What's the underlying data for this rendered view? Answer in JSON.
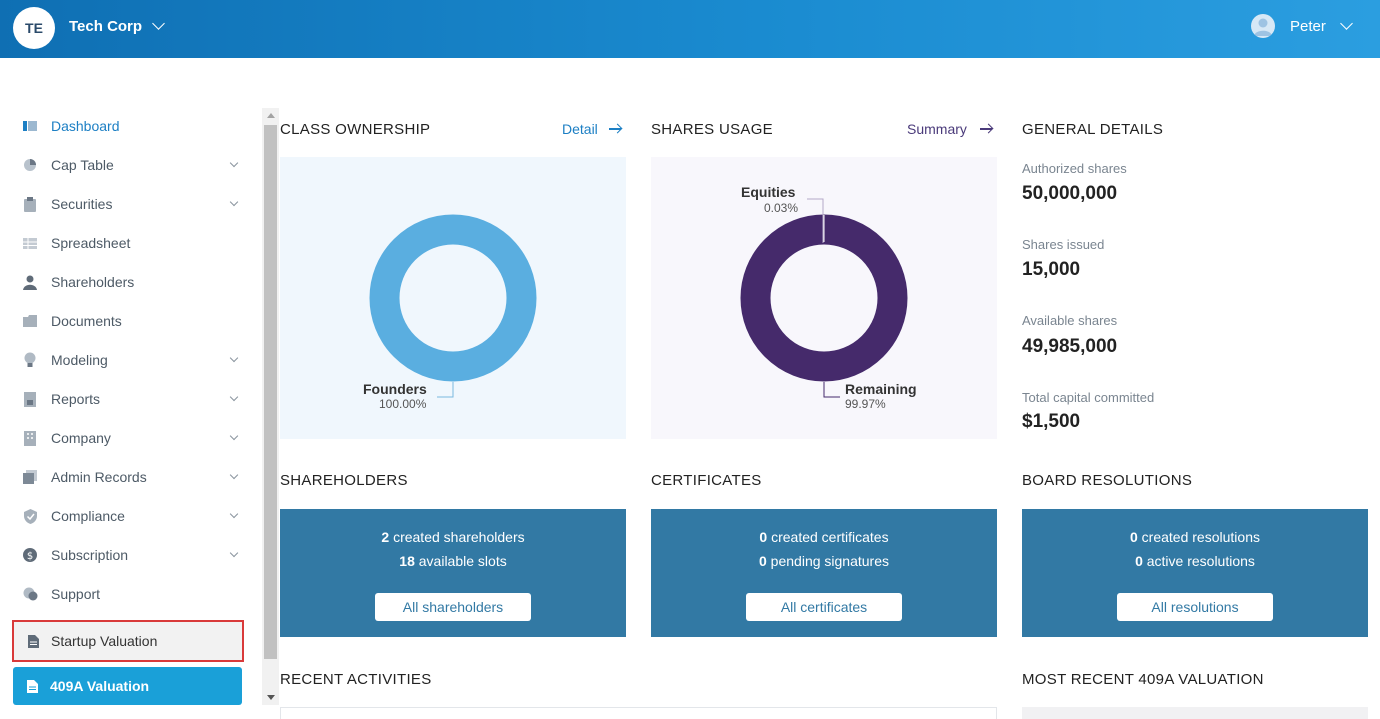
{
  "header": {
    "org_initials": "TE",
    "org_name": "Tech Corp",
    "user_name": "Peter"
  },
  "sidebar": {
    "items": [
      {
        "label": "Dashboard",
        "icon": "dashboard-icon",
        "active": true
      },
      {
        "label": "Cap Table",
        "icon": "pie-chart-icon"
      },
      {
        "label": "Securities",
        "icon": "clipboard-icon"
      },
      {
        "label": "Spreadsheet",
        "icon": "spreadsheet-icon"
      },
      {
        "label": "Shareholders",
        "icon": "person-icon"
      },
      {
        "label": "Documents",
        "icon": "folder-icon"
      },
      {
        "label": "Modeling",
        "icon": "lightbulb-icon"
      },
      {
        "label": "Reports",
        "icon": "report-icon"
      },
      {
        "label": "Company",
        "icon": "building-icon"
      },
      {
        "label": "Admin Records",
        "icon": "records-icon"
      },
      {
        "label": "Compliance",
        "icon": "shield-icon"
      },
      {
        "label": "Subscription",
        "icon": "dollar-icon"
      },
      {
        "label": "Support",
        "icon": "support-icon"
      }
    ],
    "startup_valuation": "Startup Valuation",
    "valuation_409a": "409A Valuation"
  },
  "class_ownership": {
    "title": "CLASS OWNERSHIP",
    "link": "Detail",
    "label": "Founders",
    "pct": "100.00%",
    "color": "#5aaee0",
    "value": 100
  },
  "shares_usage": {
    "title": "SHARES USAGE",
    "link": "Summary",
    "equities_label": "Equities",
    "equities_pct": "0.03%",
    "remaining_label": "Remaining",
    "remaining_pct": "99.97%",
    "color": "#452a6b",
    "equities_value": 0.03,
    "remaining_value": 99.97
  },
  "general_details": {
    "title": "GENERAL DETAILS",
    "items": [
      {
        "label": "Authorized shares",
        "value": "50,000,000"
      },
      {
        "label": "Shares issued",
        "value": "15,000"
      },
      {
        "label": "Available shares",
        "value": "49,985,000"
      },
      {
        "label": "Total capital committed",
        "value": "$1,500"
      }
    ]
  },
  "shareholders": {
    "title": "SHAREHOLDERS",
    "line1_count": "2",
    "line1_text": " created shareholders",
    "line2_count": "18",
    "line2_text": " available slots",
    "button": "All shareholders"
  },
  "certificates": {
    "title": "CERTIFICATES",
    "line1_count": "0",
    "line1_text": " created certificates",
    "line2_count": "0",
    "line2_text": " pending signatures",
    "button": "All certificates"
  },
  "board_resolutions": {
    "title": "BOARD RESOLUTIONS",
    "line1_count": "0",
    "line1_text": " created resolutions",
    "line2_count": "0",
    "line2_text": " active resolutions",
    "button": "All resolutions"
  },
  "recent_activities": {
    "title": "RECENT ACTIVITIES"
  },
  "valuation_409a": {
    "title": "MOST RECENT 409A VALUATION"
  }
}
